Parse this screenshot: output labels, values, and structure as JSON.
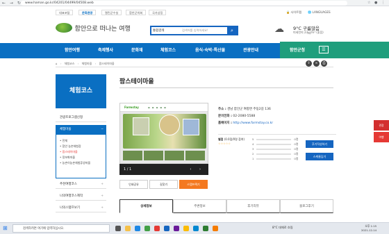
{
  "browser": {
    "nav_icons": "←  →  ↻",
    "url": "www.haman.go.kr/04201/04499/04508.web",
    "ext_icons": "☆ ● ⋮"
  },
  "top_links": [
    "대표포털",
    "문화관광",
    "열린군수실",
    "함안군의회",
    "국가상징"
  ],
  "top_right": {
    "lock": "🔒 사이트맵",
    "languages": "🌐 LANGUAGES"
  },
  "logo": {
    "text": "함안으로 떠나는 여행",
    "icon": "haman-logo"
  },
  "search": {
    "category": "통합검색",
    "placeholder": "검색어를 입력하세요!",
    "button_icon": "search-icon"
  },
  "weather": {
    "temp": "9°C 구름많음",
    "dust": "미세먼지 23㎍/m³ (좋음)",
    "icon": "cloud-icon"
  },
  "nav": {
    "items": [
      "함안여행",
      "축제행사",
      "문화재",
      "체험코스",
      "음식·숙박·특산물",
      "관광안내"
    ],
    "special": "함안군청",
    "menu_icon": "menu-icon"
  },
  "breadcrumb": {
    "home_icon": "home-icon",
    "items": [
      "체험코스",
      "체험마을",
      "팜스테이마을"
    ]
  },
  "crumb_icons": [
    "share-icon",
    "link-icon",
    "print-icon"
  ],
  "sidebar": {
    "title": "체험코스",
    "items_before": [
      "관광프로그램신청"
    ],
    "selected": "체험마을",
    "sub": [
      "전체",
      "함안 농촌체험장",
      "팜스테이마을",
      "정보화마을",
      "농촌이농촌체험휴양마을"
    ],
    "sub_active": "팜스테이마을",
    "items_after": [
      "추천여행코스",
      "나의여행코스제작",
      "나의스탬프보기"
    ]
  },
  "page": {
    "title": "팜스테이마을"
  },
  "slide": {
    "logo": "Farmstay",
    "counter": "1 / 1",
    "arrows": "‹ ›"
  },
  "ctrl_buttons": [
    "인쇄공유",
    "길찾기",
    "스탬프찍기"
  ],
  "info": {
    "address_label": "주소 :",
    "address": "경남 함안군 여항면 주동2길 136",
    "phone_label": "문의전화 :",
    "phone": "02-2080-5588",
    "homepage_label": "홈페이지 :",
    "homepage": "http://www.farmstay.co.kr"
  },
  "rating": {
    "label": "별점",
    "summary": "(0.0점/0명 참여)",
    "stars": "☆☆☆☆☆",
    "rows": [
      {
        "star": "5",
        "count": "0명"
      },
      {
        "star": "4",
        "count": "0명"
      },
      {
        "star": "3",
        "count": "0명"
      },
      {
        "star": "2",
        "count": "0명"
      },
      {
        "star": "1",
        "count": "0명"
      }
    ],
    "btn1": "후기작성하기",
    "btn2": "스케줄담기"
  },
  "tabs": [
    "상세정보",
    "주변정보",
    "후기리뷰",
    "블로그후기"
  ],
  "quick": [
    "관광",
    "여행"
  ],
  "taskbar": {
    "search": "검색하려면 여기에 입력하십시오.",
    "weather": "8°C 대체로 흐림",
    "time": "오후 1:15",
    "date": "2021-12-14"
  },
  "colors": {
    "primary": "#0a6fc2",
    "green": "#1f9e7c",
    "orange": "#f47920"
  }
}
